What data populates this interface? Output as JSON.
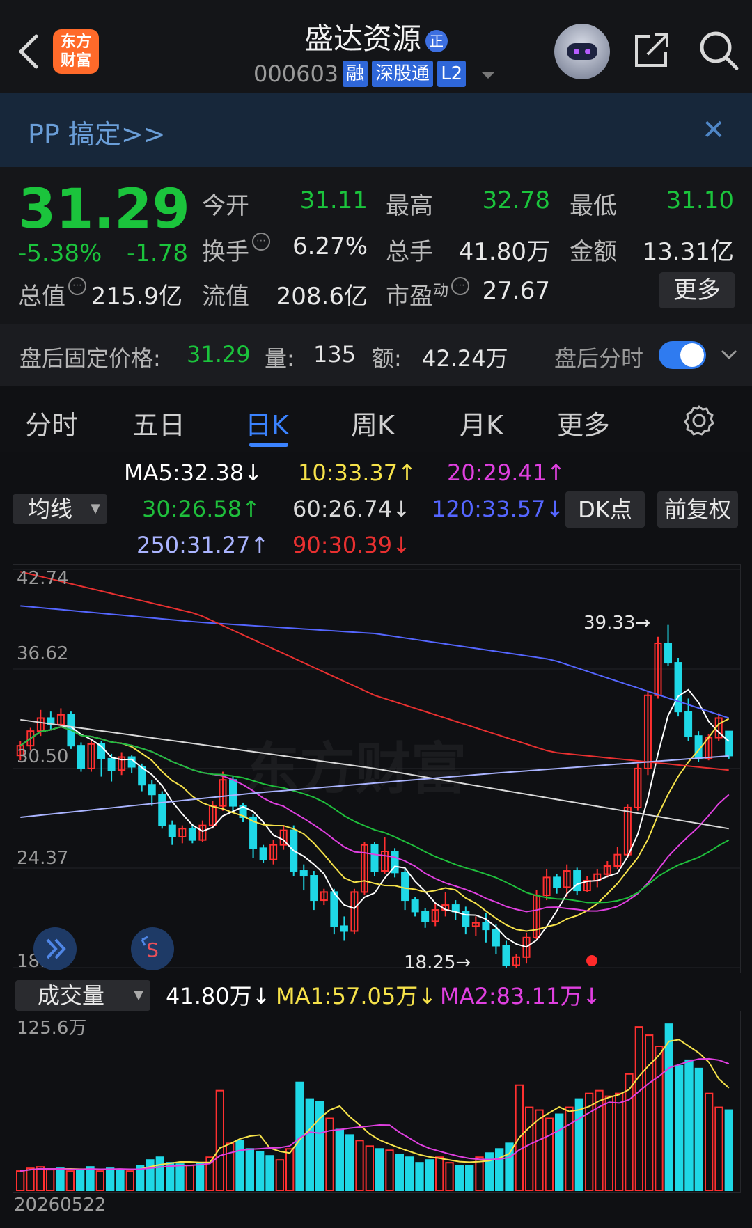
{
  "header": {
    "logo_text_1": "东方",
    "logo_text_2": "财富",
    "title": "盛达资源",
    "title_badge": "正",
    "code": "000603",
    "tags": [
      "融",
      "深股通",
      "L2"
    ]
  },
  "banner": {
    "text": "PP 搞定>>",
    "close": "✕"
  },
  "quote": {
    "price": "31.29",
    "change_pct": "-5.38%",
    "change_abs": "-1.78",
    "today_open_label": "今开",
    "today_open": "31.11",
    "high_label": "最高",
    "high": "32.78",
    "low_label": "最低",
    "low": "31.10",
    "turnover_label": "换手",
    "turnover": "6.27%",
    "total_hands_label": "总手",
    "total_hands": "41.80万",
    "amount_label": "金额",
    "amount": "13.31亿",
    "market_value_label": "总值",
    "market_value": "215.9亿",
    "float_value_label": "流值",
    "float_value": "208.6亿",
    "pe_label": "市盈",
    "pe_sup": "动",
    "pe": "27.67",
    "more": "更多"
  },
  "after_hours": {
    "label": "盘后固定价格:",
    "price": "31.29",
    "vol_label": "量:",
    "vol": "135",
    "amt_label": "额:",
    "amt": "42.24万",
    "time_label": "盘后分时"
  },
  "tabs": [
    "分时",
    "五日",
    "日K",
    "周K",
    "月K",
    "更多"
  ],
  "ma_legend": {
    "ma5": "MA5:32.38↓",
    "ma10": "10:33.37↑",
    "ma20": "20:29.41↑",
    "ma30": "30:26.58↑",
    "ma60": "60:26.74↓",
    "ma120": "120:33.57↓",
    "ma250": "250:31.27↑",
    "ma90": "90:30.39↓",
    "selector": "均线",
    "dk": "DK点",
    "adjust": "前复权"
  },
  "colors": {
    "up": "#ff3030",
    "down": "#1fd8e6",
    "ma5": "#ffffff",
    "ma10": "#f6e24a",
    "ma20": "#e040e0",
    "ma30": "#1fbf3c",
    "ma60": "#d9d9d9",
    "ma120": "#5566ff",
    "ma250": "#aab4ff",
    "ma90": "#e83030"
  },
  "price_chart": {
    "y_ticks": [
      "42.74",
      "36.62",
      "30.50",
      "24.37",
      "18.25"
    ],
    "high_marker": "39.33→",
    "low_marker": "18.25→"
  },
  "volume": {
    "selector": "成交量",
    "current": "41.80万↓",
    "ma1": "MA1:57.05万↓",
    "ma2": "MA2:83.11万↓",
    "y_top": "125.6万"
  },
  "date": "20260522",
  "chart_data": {
    "type": "candlestick",
    "ylim": [
      18.25,
      42.74
    ],
    "y_ticks": [
      42.74,
      36.62,
      30.5,
      24.37,
      18.25
    ],
    "candles": [
      [
        31.3,
        31.9,
        31.0,
        32.2
      ],
      [
        31.9,
        32.8,
        31.6,
        33.0
      ],
      [
        32.8,
        33.6,
        32.5,
        34.1
      ],
      [
        33.6,
        33.2,
        32.9,
        34.0
      ],
      [
        33.2,
        33.8,
        33.0,
        34.2
      ],
      [
        33.8,
        31.9,
        31.7,
        34.0
      ],
      [
        31.9,
        30.5,
        30.3,
        32.1
      ],
      [
        30.5,
        32.0,
        30.3,
        32.3
      ],
      [
        32.0,
        31.1,
        30.0,
        32.2
      ],
      [
        31.1,
        30.4,
        29.7,
        31.4
      ],
      [
        30.4,
        31.2,
        30.1,
        31.5
      ],
      [
        31.2,
        30.6,
        30.2,
        31.3
      ],
      [
        30.6,
        29.5,
        29.1,
        30.8
      ],
      [
        29.5,
        28.9,
        28.2,
        29.8
      ],
      [
        28.9,
        27.0,
        26.8,
        29.1
      ],
      [
        27.0,
        26.3,
        25.8,
        27.3
      ],
      [
        26.3,
        26.8,
        25.9,
        27.0
      ],
      [
        26.8,
        26.1,
        25.9,
        27.1
      ],
      [
        26.1,
        27.0,
        26.0,
        27.3
      ],
      [
        27.0,
        28.2,
        26.8,
        28.5
      ],
      [
        28.2,
        29.8,
        27.9,
        30.3
      ],
      [
        29.8,
        28.2,
        27.8,
        30.0
      ],
      [
        28.2,
        27.5,
        27.2,
        28.4
      ],
      [
        27.5,
        25.6,
        25.0,
        27.7
      ],
      [
        25.6,
        24.9,
        24.7,
        25.8
      ],
      [
        24.9,
        25.8,
        24.6,
        26.1
      ],
      [
        25.8,
        26.7,
        25.5,
        27.0
      ],
      [
        26.7,
        24.2,
        23.9,
        27.0
      ],
      [
        24.2,
        23.9,
        23.0,
        24.6
      ],
      [
        23.9,
        22.4,
        21.8,
        24.2
      ],
      [
        22.4,
        22.9,
        22.1,
        23.1
      ],
      [
        22.9,
        20.8,
        20.3,
        23.1
      ],
      [
        20.8,
        20.5,
        19.9,
        21.4
      ],
      [
        20.5,
        22.9,
        20.3,
        23.1
      ],
      [
        22.9,
        25.8,
        22.7,
        26.0
      ],
      [
        25.8,
        24.2,
        23.9,
        26.0
      ],
      [
        24.2,
        25.4,
        24.0,
        26.3
      ],
      [
        25.4,
        24.1,
        23.8,
        25.6
      ],
      [
        24.1,
        22.4,
        21.8,
        24.3
      ],
      [
        22.4,
        21.7,
        21.4,
        22.6
      ],
      [
        21.7,
        21.1,
        20.7,
        21.9
      ],
      [
        21.1,
        21.8,
        20.8,
        22.2
      ],
      [
        21.8,
        22.1,
        21.4,
        22.9
      ],
      [
        22.1,
        21.7,
        21.2,
        22.4
      ],
      [
        21.7,
        20.8,
        20.3,
        22.0
      ],
      [
        20.8,
        21.0,
        20.2,
        21.4
      ],
      [
        21.0,
        20.6,
        19.8,
        21.6
      ],
      [
        20.6,
        19.6,
        19.1,
        20.9
      ],
      [
        19.6,
        18.4,
        18.25,
        19.9
      ],
      [
        18.4,
        18.9,
        18.25,
        19.1
      ],
      [
        18.9,
        20.1,
        18.5,
        20.4
      ],
      [
        20.1,
        22.7,
        20.0,
        23.0
      ],
      [
        22.7,
        23.8,
        22.4,
        24.3
      ],
      [
        23.8,
        23.2,
        22.8,
        24.0
      ],
      [
        23.2,
        24.2,
        22.6,
        24.6
      ],
      [
        24.2,
        23.0,
        22.7,
        24.4
      ],
      [
        23.0,
        23.6,
        22.9,
        23.9
      ],
      [
        23.6,
        24.0,
        23.2,
        24.3
      ],
      [
        24.0,
        24.5,
        23.8,
        24.8
      ],
      [
        24.5,
        25.2,
        24.3,
        25.7
      ],
      [
        25.2,
        28.1,
        25.0,
        28.3
      ],
      [
        28.1,
        30.5,
        27.9,
        30.8
      ],
      [
        30.5,
        35.0,
        30.1,
        35.3
      ],
      [
        35.0,
        38.2,
        34.8,
        38.6
      ],
      [
        38.2,
        37.0,
        36.8,
        39.33
      ],
      [
        37.0,
        34.0,
        33.7,
        37.3
      ],
      [
        34.0,
        32.5,
        32.2,
        34.8
      ],
      [
        32.5,
        31.1,
        30.9,
        32.8
      ],
      [
        31.1,
        32.4,
        31.0,
        32.6
      ],
      [
        32.4,
        33.6,
        32.2,
        33.9
      ],
      [
        32.78,
        31.29,
        31.1,
        32.78
      ]
    ],
    "volume": [
      14,
      16,
      17,
      15,
      16,
      14,
      15,
      17,
      14,
      16,
      15,
      14,
      18,
      22,
      24,
      20,
      19,
      18,
      20,
      24,
      72,
      34,
      36,
      30,
      28,
      25,
      22,
      30,
      78,
      66,
      64,
      52,
      44,
      40,
      36,
      32,
      30,
      29,
      26,
      24,
      20,
      22,
      24,
      20,
      18,
      18,
      24,
      27,
      30,
      34,
      76,
      60,
      58,
      52,
      55,
      60,
      66,
      70,
      72,
      68,
      70,
      84,
      118,
      112,
      104,
      120,
      90,
      94,
      88,
      70,
      60,
      58
    ],
    "volume_ylim": [
      0,
      125.6
    ]
  }
}
